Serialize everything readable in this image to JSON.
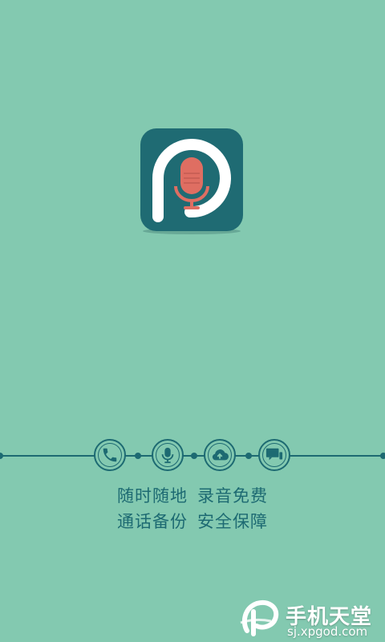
{
  "colors": {
    "background": "#83c9b0",
    "logo_bg": "#1f6b73",
    "logo_ring": "#ffffff",
    "mic": "#df6e62",
    "line": "#1d6a72"
  },
  "splash": {
    "logo_icon": "microphone-logo"
  },
  "features": {
    "icons": [
      "phone-icon",
      "microphone-icon",
      "cloud-upload-icon",
      "chat-icon"
    ]
  },
  "slogan": {
    "line1_part1": "随时随地",
    "line1_part2": "录音免费",
    "line2_part1": "通话备份",
    "line2_part2": "安全保障"
  },
  "watermark": {
    "title": "手机天堂",
    "url": "sj.xpgod.com"
  }
}
